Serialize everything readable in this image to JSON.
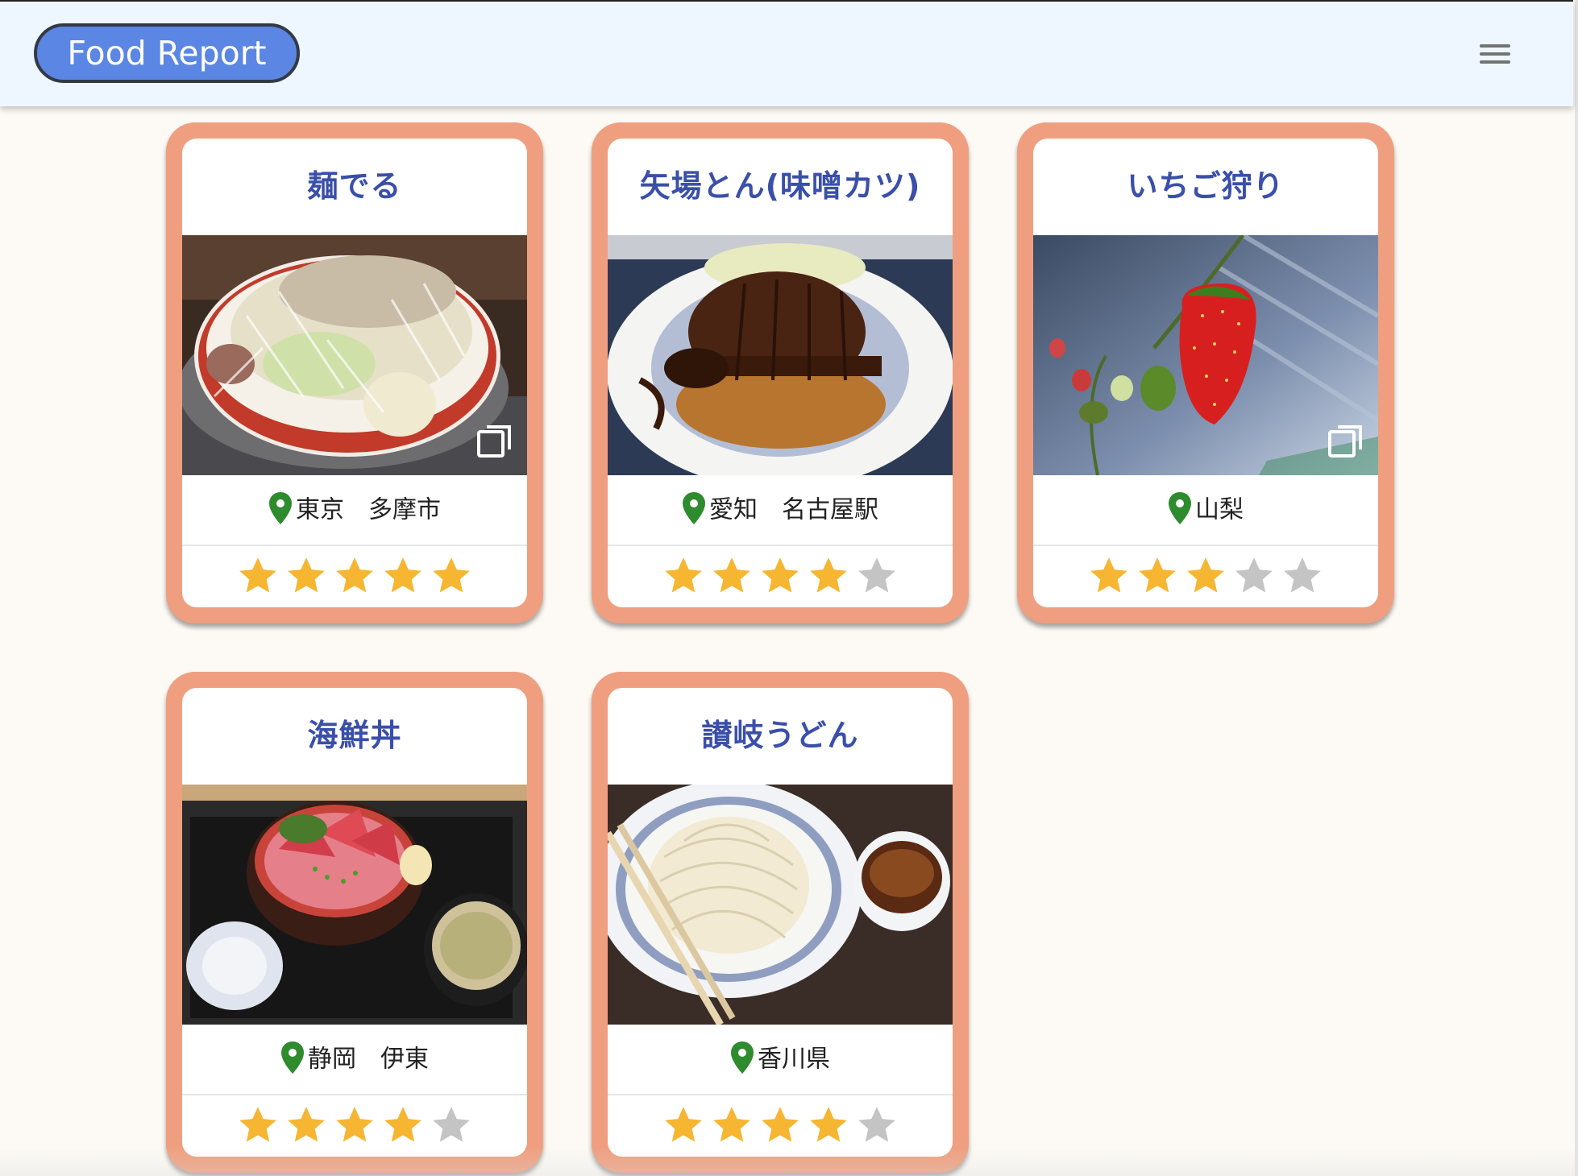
{
  "header": {
    "brand": "Food Report",
    "menu_icon": "hamburger-menu-icon"
  },
  "colors": {
    "header_bg": "#eef6ff",
    "brand_bg": "#5b86e3",
    "card_frame": "#ef9f7f",
    "title_text": "#3a4faa",
    "pin": "#2e8b2e",
    "star_on": "#f6b632",
    "star_off": "#c4c4c4"
  },
  "cards": [
    {
      "title": "麺でる",
      "location": "東京　多摩市",
      "rating": 5,
      "max_rating": 5,
      "has_gallery": true,
      "photo": "ramen-photo"
    },
    {
      "title": "矢場とん(味噌カツ)",
      "location": "愛知　名古屋駅",
      "rating": 4,
      "max_rating": 5,
      "has_gallery": false,
      "photo": "miso-katsu-photo"
    },
    {
      "title": "いちご狩り",
      "location": "山梨",
      "rating": 3,
      "max_rating": 5,
      "has_gallery": true,
      "photo": "strawberry-photo"
    },
    {
      "title": "海鮮丼",
      "location": "静岡　伊東",
      "rating": 4,
      "max_rating": 5,
      "has_gallery": false,
      "photo": "seafood-bowl-photo"
    },
    {
      "title": "讃岐うどん",
      "location": "香川県",
      "rating": 4,
      "max_rating": 5,
      "has_gallery": false,
      "photo": "udon-photo"
    }
  ]
}
